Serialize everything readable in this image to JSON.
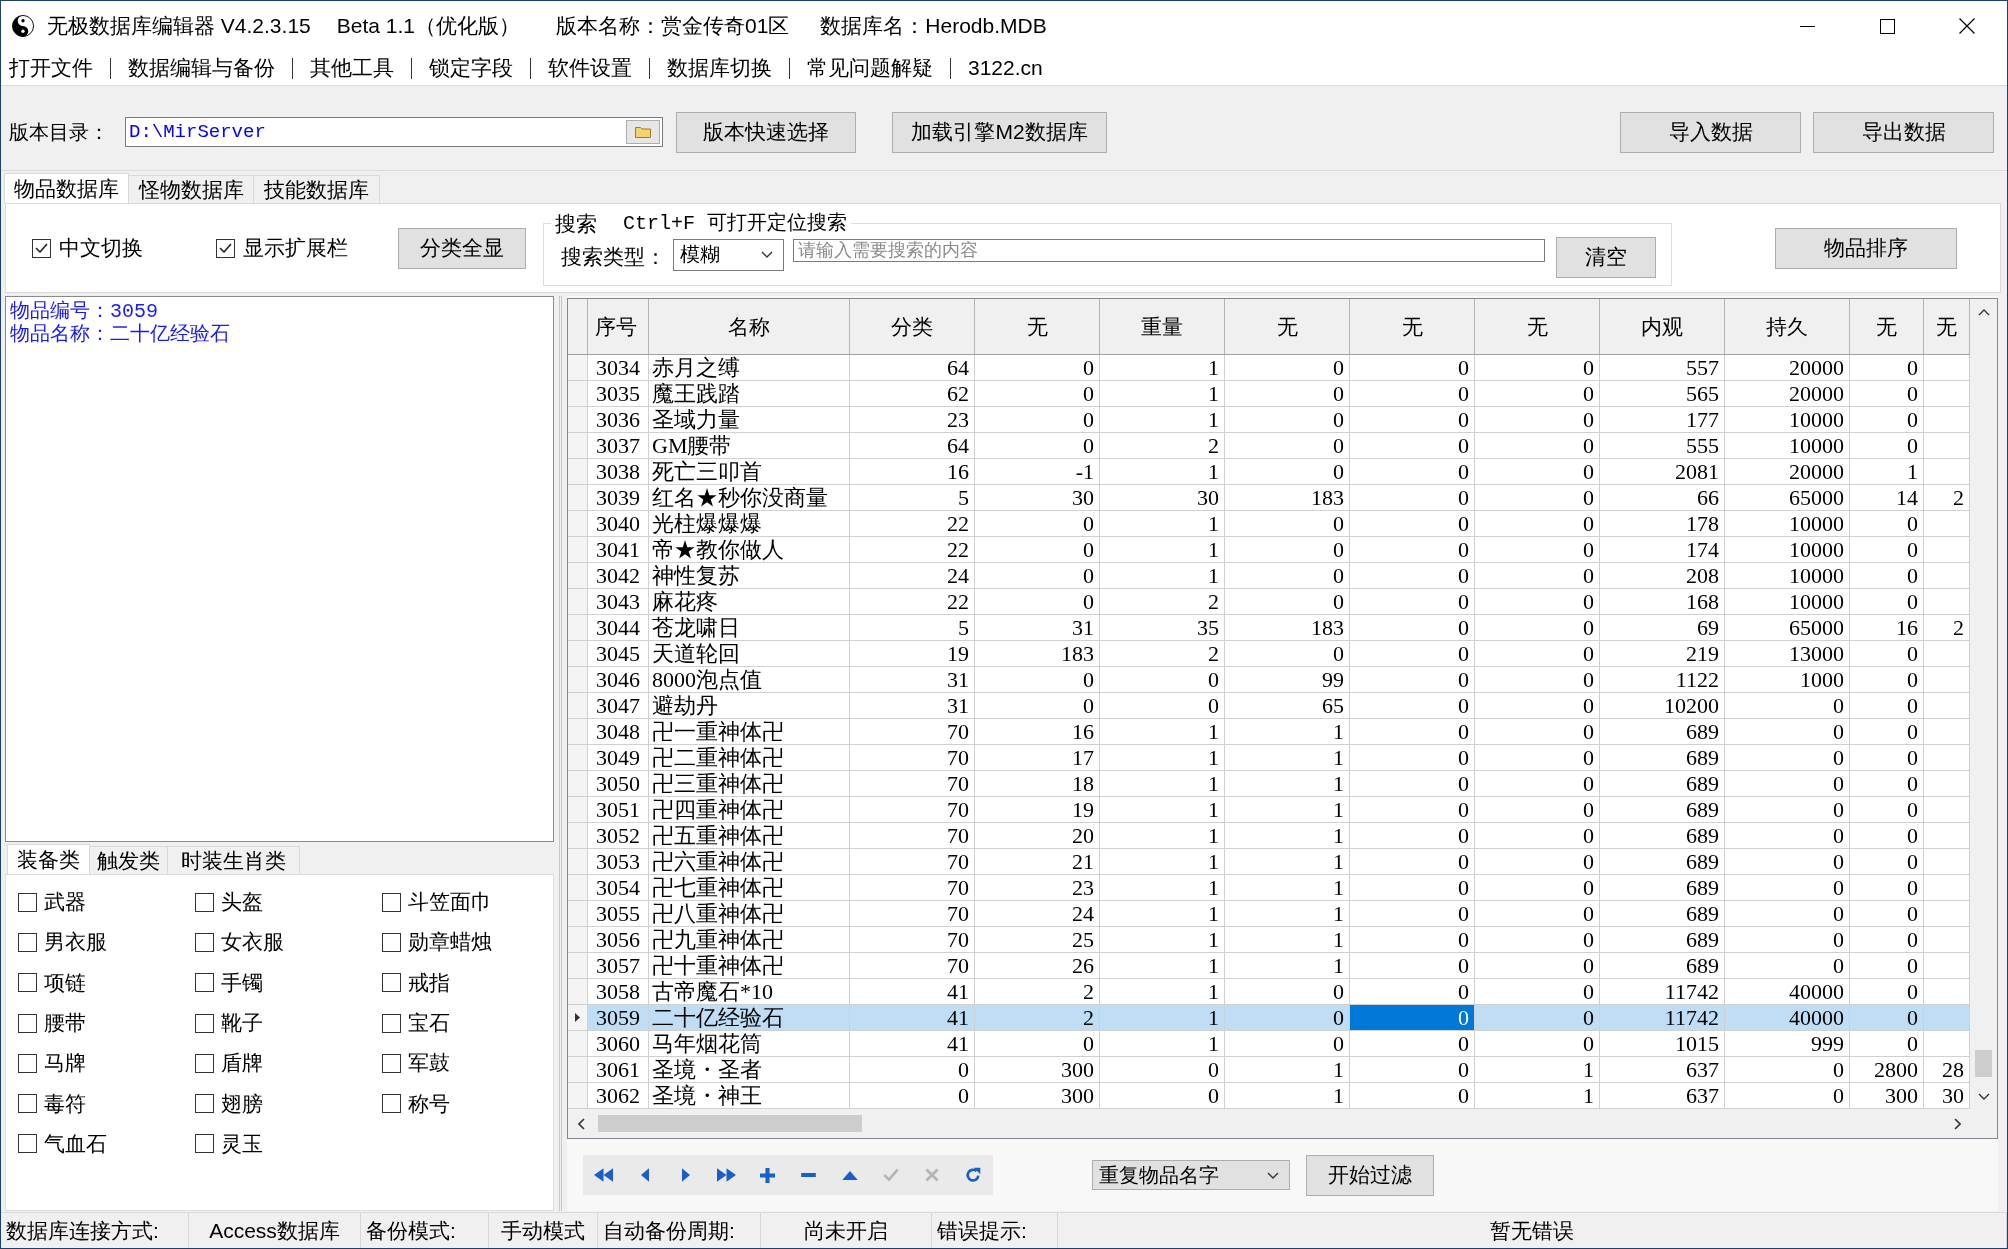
{
  "window": {
    "title": "无极数据库编辑器 V4.2.3.15",
    "edition": "Beta 1.1（优化版）",
    "version_name": "版本名称：赏金传奇01区",
    "database_name": "数据库名：Herodb.MDB"
  },
  "menu": [
    "打开文件",
    "数据编辑与备份",
    "其他工具",
    "锁定字段",
    "软件设置",
    "数据库切换",
    "常见问题解疑",
    "3122.cn"
  ],
  "toolbar": {
    "path_label": "版本目录：",
    "path_value": "D:\\MirServer",
    "buttons": [
      "版本快速选择",
      "加载引擎M2数据库"
    ],
    "data_buttons": [
      "导入数据",
      "导出数据"
    ]
  },
  "tabs": [
    {
      "label": "物品数据库",
      "selected": true
    },
    {
      "label": "怪物数据库",
      "selected": false
    },
    {
      "label": "技能数据库",
      "selected": false
    }
  ],
  "options": {
    "checkboxes": [
      {
        "label": "中文切换",
        "checked": true
      },
      {
        "label": "显示扩展栏",
        "checked": true
      }
    ],
    "show_all_button": "分类全显"
  },
  "search": {
    "title": "搜索",
    "hint": "Ctrl+F 可打开定位搜索",
    "type_label": "搜索类型：",
    "type_value": "模糊",
    "placeholder": "请输入需要搜索的内容",
    "clear_button": "清空"
  },
  "sort_button": "物品排序",
  "item_info": [
    "物品编号：3059",
    "物品名称：二十亿经验石"
  ],
  "category_tabs": [
    {
      "label": "装备类",
      "selected": true
    },
    {
      "label": "触发类",
      "selected": false
    },
    {
      "label": "时装生肖类",
      "selected": false
    }
  ],
  "categories": [
    {
      "label": "武器",
      "checked": false
    },
    {
      "label": "头盔",
      "checked": false
    },
    {
      "label": "斗笠面巾",
      "checked": false
    },
    {
      "label": "男衣服",
      "checked": false
    },
    {
      "label": "女衣服",
      "checked": false
    },
    {
      "label": "勋章蜡烛",
      "checked": false
    },
    {
      "label": "项链",
      "checked": false
    },
    {
      "label": "手镯",
      "checked": false
    },
    {
      "label": "戒指",
      "checked": false
    },
    {
      "label": "腰带",
      "checked": false
    },
    {
      "label": "靴子",
      "checked": false
    },
    {
      "label": "宝石",
      "checked": false
    },
    {
      "label": "马牌",
      "checked": false
    },
    {
      "label": "盾牌",
      "checked": false
    },
    {
      "label": "军鼓",
      "checked": false
    },
    {
      "label": "毒符",
      "checked": false
    },
    {
      "label": "翅膀",
      "checked": false
    },
    {
      "label": "称号",
      "checked": false
    },
    {
      "label": "气血石",
      "checked": false
    },
    {
      "label": "灵玉",
      "checked": false
    }
  ],
  "table": {
    "columns": [
      "序号",
      "名称",
      "分类",
      "无",
      "重量",
      "无",
      "无",
      "无",
      "内观",
      "持久",
      "无",
      "无"
    ],
    "rows": [
      {
        "selected": false,
        "cells": [
          "3034",
          "赤月之缚",
          "64",
          "0",
          "1",
          "0",
          "0",
          "0",
          "557",
          "20000",
          "0"
        ]
      },
      {
        "selected": false,
        "cells": [
          "3035",
          "魔王践踏",
          "62",
          "0",
          "1",
          "0",
          "0",
          "0",
          "565",
          "20000",
          "0"
        ]
      },
      {
        "selected": false,
        "cells": [
          "3036",
          "圣域力量",
          "23",
          "0",
          "1",
          "0",
          "0",
          "0",
          "177",
          "10000",
          "0"
        ]
      },
      {
        "selected": false,
        "cells": [
          "3037",
          "GM腰带",
          "64",
          "0",
          "2",
          "0",
          "0",
          "0",
          "555",
          "10000",
          "0"
        ]
      },
      {
        "selected": false,
        "cells": [
          "3038",
          "死亡三叩首",
          "16",
          "-1",
          "1",
          "0",
          "0",
          "0",
          "2081",
          "20000",
          "1"
        ]
      },
      {
        "selected": false,
        "cells": [
          "3039",
          "红名★秒你没商量",
          "5",
          "30",
          "30",
          "183",
          "0",
          "0",
          "66",
          "65000",
          "14",
          "2"
        ]
      },
      {
        "selected": false,
        "cells": [
          "3040",
          "光柱爆爆爆",
          "22",
          "0",
          "1",
          "0",
          "0",
          "0",
          "178",
          "10000",
          "0"
        ]
      },
      {
        "selected": false,
        "cells": [
          "3041",
          "帝★教你做人",
          "22",
          "0",
          "1",
          "0",
          "0",
          "0",
          "174",
          "10000",
          "0"
        ]
      },
      {
        "selected": false,
        "cells": [
          "3042",
          "神性复苏",
          "24",
          "0",
          "1",
          "0",
          "0",
          "0",
          "208",
          "10000",
          "0"
        ]
      },
      {
        "selected": false,
        "cells": [
          "3043",
          "麻花疼",
          "22",
          "0",
          "2",
          "0",
          "0",
          "0",
          "168",
          "10000",
          "0"
        ]
      },
      {
        "selected": false,
        "cells": [
          "3044",
          "苍龙啸日",
          "5",
          "31",
          "35",
          "183",
          "0",
          "0",
          "69",
          "65000",
          "16",
          "2"
        ]
      },
      {
        "selected": false,
        "cells": [
          "3045",
          "天道轮回",
          "19",
          "183",
          "2",
          "0",
          "0",
          "0",
          "219",
          "13000",
          "0"
        ]
      },
      {
        "selected": false,
        "cells": [
          "3046",
          "8000泡点值",
          "31",
          "0",
          "0",
          "99",
          "0",
          "0",
          "1122",
          "1000",
          "0"
        ]
      },
      {
        "selected": false,
        "cells": [
          "3047",
          "避劫丹",
          "31",
          "0",
          "0",
          "65",
          "0",
          "0",
          "10200",
          "0",
          "0"
        ]
      },
      {
        "selected": false,
        "cells": [
          "3048",
          "卍一重神体卍",
          "70",
          "16",
          "1",
          "1",
          "0",
          "0",
          "689",
          "0",
          "0"
        ]
      },
      {
        "selected": false,
        "cells": [
          "3049",
          "卍二重神体卍",
          "70",
          "17",
          "1",
          "1",
          "0",
          "0",
          "689",
          "0",
          "0"
        ]
      },
      {
        "selected": false,
        "cells": [
          "3050",
          "卍三重神体卍",
          "70",
          "18",
          "1",
          "1",
          "0",
          "0",
          "689",
          "0",
          "0"
        ]
      },
      {
        "selected": false,
        "cells": [
          "3051",
          "卍四重神体卍",
          "70",
          "19",
          "1",
          "1",
          "0",
          "0",
          "689",
          "0",
          "0"
        ]
      },
      {
        "selected": false,
        "cells": [
          "3052",
          "卍五重神体卍",
          "70",
          "20",
          "1",
          "1",
          "0",
          "0",
          "689",
          "0",
          "0"
        ]
      },
      {
        "selected": false,
        "cells": [
          "3053",
          "卍六重神体卍",
          "70",
          "21",
          "1",
          "1",
          "0",
          "0",
          "689",
          "0",
          "0"
        ]
      },
      {
        "selected": false,
        "cells": [
          "3054",
          "卍七重神体卍",
          "70",
          "23",
          "1",
          "1",
          "0",
          "0",
          "689",
          "0",
          "0"
        ]
      },
      {
        "selected": false,
        "cells": [
          "3055",
          "卍八重神体卍",
          "70",
          "24",
          "1",
          "1",
          "0",
          "0",
          "689",
          "0",
          "0"
        ]
      },
      {
        "selected": false,
        "cells": [
          "3056",
          "卍九重神体卍",
          "70",
          "25",
          "1",
          "1",
          "0",
          "0",
          "689",
          "0",
          "0"
        ]
      },
      {
        "selected": false,
        "cells": [
          "3057",
          "卍十重神体卍",
          "70",
          "26",
          "1",
          "1",
          "0",
          "0",
          "689",
          "0",
          "0"
        ]
      },
      {
        "selected": false,
        "cells": [
          "3058",
          "古帝魔石*10",
          "41",
          "2",
          "1",
          "0",
          "0",
          "0",
          "11742",
          "40000",
          "0"
        ]
      },
      {
        "selected": true,
        "cells": [
          "3059",
          "二十亿经验石",
          "41",
          "2",
          "1",
          "0",
          {
            "text": "0",
            "focused": true
          },
          "0",
          "11742",
          "40000",
          "0"
        ]
      },
      {
        "selected": false,
        "cells": [
          "3060",
          "马年烟花筒",
          "41",
          "0",
          "1",
          "0",
          "0",
          "0",
          "1015",
          "999",
          "0"
        ]
      },
      {
        "selected": false,
        "cells": [
          "3061",
          "圣境・圣者",
          "0",
          "300",
          "0",
          "1",
          "0",
          "1",
          "637",
          "0",
          "2800",
          "28"
        ]
      },
      {
        "selected": false,
        "cells": [
          "3062",
          "圣境・神王",
          "0",
          "300",
          "0",
          "1",
          "0",
          "1",
          "637",
          "0",
          "300",
          "30"
        ]
      }
    ]
  },
  "navigator": [
    {
      "kind": "first",
      "disabled": false
    },
    {
      "kind": "prior",
      "disabled": false
    },
    {
      "kind": "next",
      "disabled": false
    },
    {
      "kind": "last",
      "disabled": false
    },
    {
      "kind": "insert",
      "disabled": false
    },
    {
      "kind": "delete",
      "disabled": false
    },
    {
      "kind": "edit",
      "disabled": false
    },
    {
      "kind": "post",
      "disabled": true
    },
    {
      "kind": "cancel",
      "disabled": true
    },
    {
      "kind": "refresh",
      "disabled": false
    }
  ],
  "filter": {
    "mode": "重复物品名字",
    "button": "开始过滤"
  },
  "status_bar": [
    {
      "label": "数据库连接方式:",
      "value": "Access数据库"
    },
    {
      "label": "备份模式:",
      "value": "手动模式"
    },
    {
      "label": "自动备份周期:",
      "value": "尚未开启"
    },
    {
      "label": "错误提示:",
      "value": "暂无错误"
    }
  ]
}
